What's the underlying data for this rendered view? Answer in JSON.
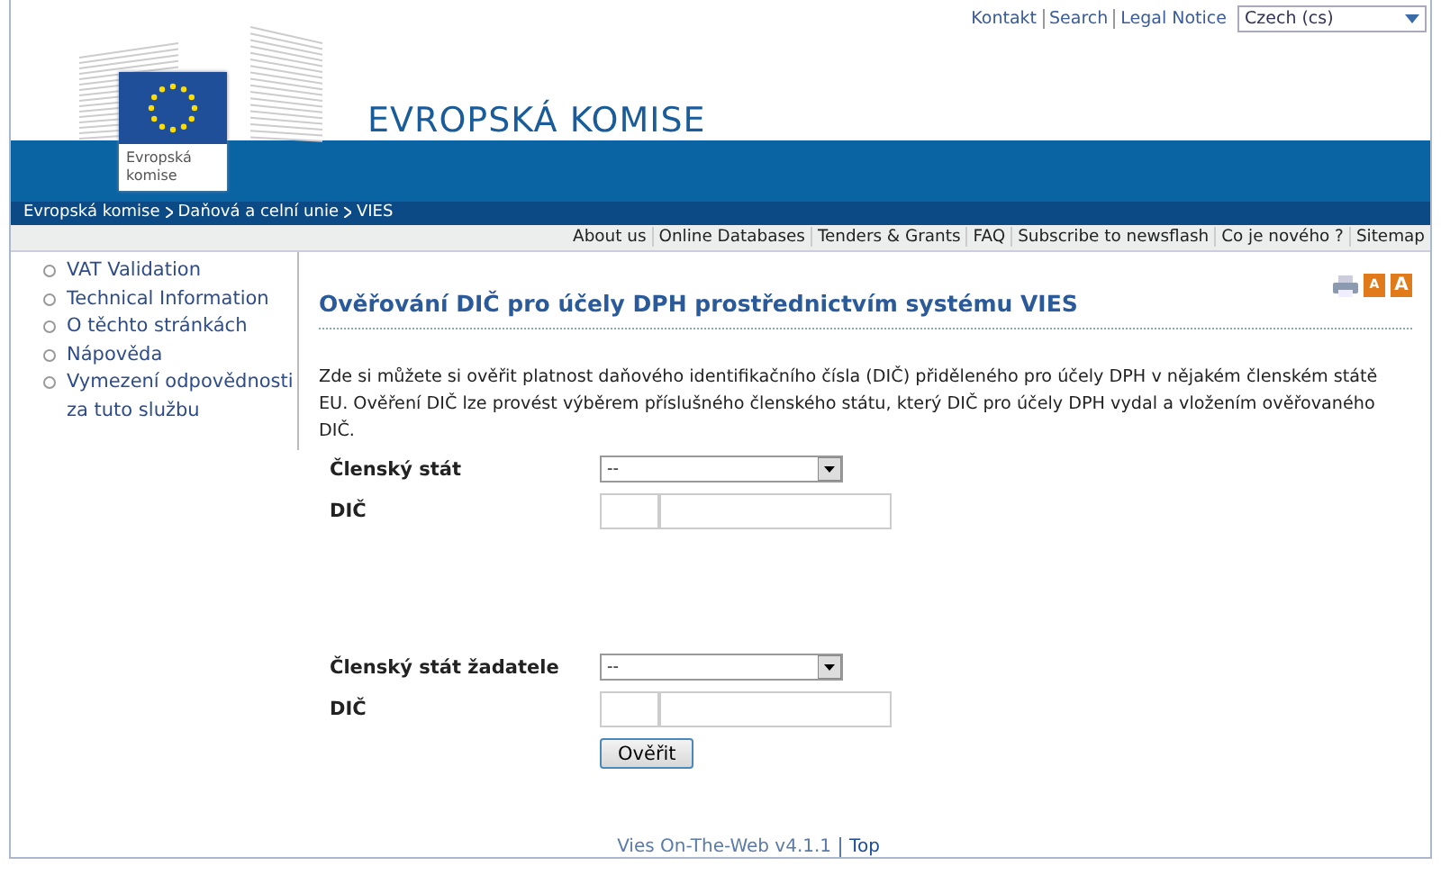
{
  "top_links": [
    "Kontakt",
    "Search",
    "Legal Notice"
  ],
  "language": {
    "value": "Czech (cs)"
  },
  "logo": {
    "caption": "Evropská komise"
  },
  "site_title": "EVROPSKÁ KOMISE",
  "breadcrumb": [
    "Evropská komise",
    "Daňová a celní unie",
    "VIES"
  ],
  "nav": [
    "About us",
    "Online Databases",
    "Tenders & Grants",
    "FAQ",
    "Subscribe to newsflash",
    "Co je nového ?",
    "Sitemap"
  ],
  "sidebar": {
    "items": [
      {
        "label": "VAT Validation"
      },
      {
        "label": "Technical Information"
      },
      {
        "label": "O těchto stránkách"
      },
      {
        "label": "Nápověda"
      },
      {
        "label": "Vymezení odpovědnosti za tuto službu"
      }
    ]
  },
  "page_title": "Ověřování DIČ pro účely DPH prostřednictvím systému VIES",
  "font_buttons": [
    "A",
    "A"
  ],
  "intro": "Zde si můžete si ověřit platnost daňového identifikačního čísla (DIČ) přiděleného pro účely DPH v nějakém členském státě EU. Ověření DIČ lze provést výběrem příslušného členského státu, který DIČ pro účely DPH vydal a vložením ověřovaného DIČ.",
  "form_groups": [
    {
      "select_label": "Členský stát",
      "select_value": "--",
      "vat_label": "DIČ"
    },
    {
      "select_label": "Členský stát žadatele",
      "select_value": "--",
      "vat_label": "DIČ"
    }
  ],
  "submit": "Ověřit",
  "footer": {
    "version": "Vies On-The-Web v4.1.1",
    "link": "Top"
  }
}
